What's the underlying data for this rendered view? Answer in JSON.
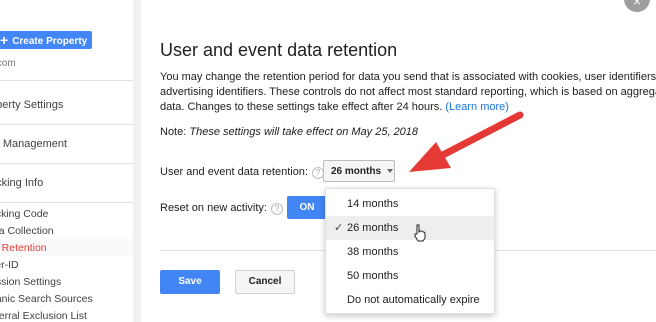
{
  "sidebar": {
    "create_label": "Create Property",
    "account_text": ".com",
    "sections": [
      "operty Settings",
      "er Management",
      "acking Info"
    ],
    "items": [
      "acking Code",
      "ata Collection",
      "ta Retention",
      "ser-ID",
      "ession Settings",
      "ganic Search Sources",
      "eferral Exclusion List"
    ],
    "active_index": 2
  },
  "main": {
    "title": "User and event data retention",
    "description": "You may change the retention period for data you send that is associated with cookies, user identifiers, or advertising identifiers. These controls do not affect most standard reporting, which is based on aggregated data. Changes to these settings take effect after 24 hours. ",
    "learn_more": "(Learn more)",
    "note_prefix": "Note: ",
    "note_text": "These settings will take effect on May 25, 2018",
    "retention_label": "User and event data retention:",
    "retention_value": "26 months",
    "reset_label": "Reset on new activity:",
    "toggle_label": "ON",
    "help_glyph": "?",
    "save_label": "Save",
    "cancel_label": "Cancel"
  },
  "dropdown": {
    "options": [
      "14 months",
      "26 months",
      "38 months",
      "50 months",
      "Do not automatically expire"
    ],
    "selected_index": 1,
    "check_glyph": "✓"
  },
  "colors": {
    "accent": "#4285f4",
    "arrow": "#e53935",
    "active_item": "#e53935",
    "link": "#1a73e8"
  },
  "icons": [
    "plus-icon",
    "help-icon",
    "chevron-down-icon",
    "checkmark-icon",
    "hand-cursor-icon",
    "close-icon",
    "annotation-arrow"
  ],
  "close_glyph": "×"
}
